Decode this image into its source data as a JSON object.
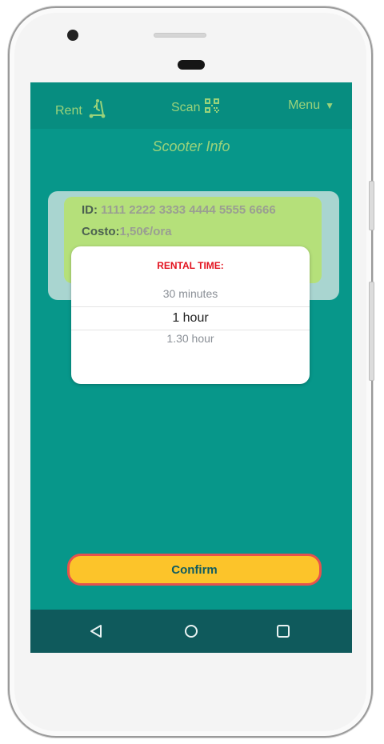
{
  "app": {
    "nav": {
      "rent_label": "Rent",
      "scan_label": "Scan",
      "menu_label": "Menu",
      "menu_caret": "▼"
    },
    "page_title": "Scooter Info"
  },
  "scooter": {
    "id_label": "ID:",
    "id_value": "1111 2222 3333 4444 5555 6666",
    "cost_label": "Costo:",
    "cost_value": "1,50€/ora"
  },
  "picker": {
    "title": "RENTAL TIME:",
    "options": [
      "30 minutes",
      "1 hour",
      "1.30 hour"
    ],
    "selected": "1 hour"
  },
  "actions": {
    "confirm_label": "Confirm"
  },
  "icons": {
    "rent": "scooter-icon",
    "scan": "qr-code-icon",
    "menu": "caret-down-icon",
    "back": "back-triangle-icon",
    "home": "home-circle-icon",
    "recents": "recents-square-icon"
  },
  "colors": {
    "screen_bg": "#07978a",
    "accent_green": "#9ad27a",
    "card_green": "#b5e07a",
    "dialog_title": "#e2121e",
    "confirm_bg": "#fcc42a",
    "confirm_border": "#e5524d",
    "android_nav": "#0f5a5c"
  }
}
